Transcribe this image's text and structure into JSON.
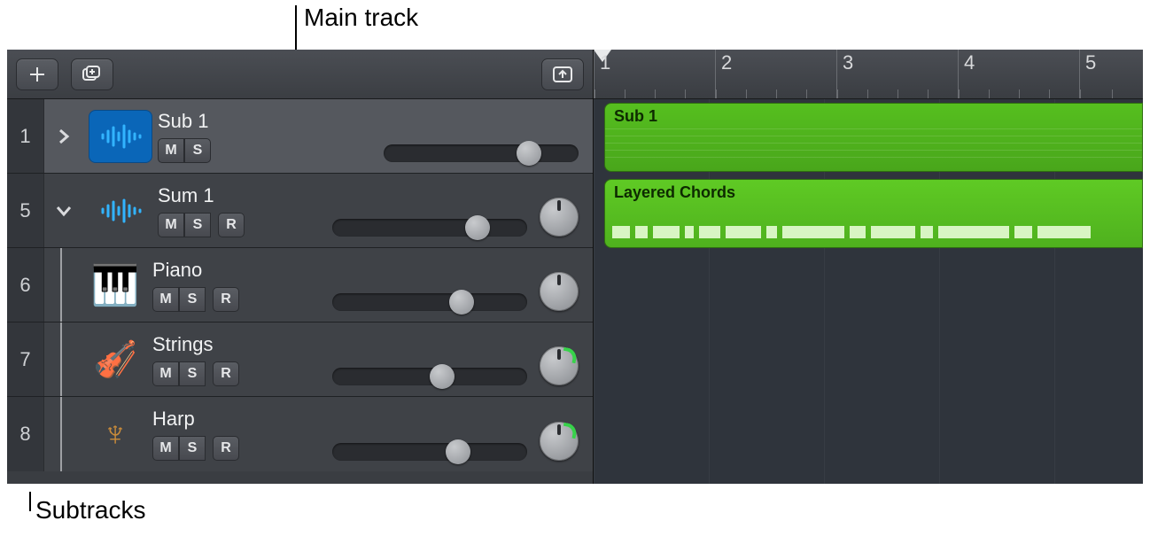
{
  "annotations": {
    "main_track": "Main track",
    "subtracks": "Subtracks"
  },
  "toolbar": {
    "add_label": "+",
    "add_track_stack_label": "⊕",
    "collapse_label": "⤒"
  },
  "ruler": {
    "marks": [
      "1",
      "2",
      "3",
      "4",
      "5"
    ]
  },
  "tracks": [
    {
      "number": "1",
      "name": "Sub 1",
      "expandable": true,
      "expanded": false,
      "selected": true,
      "icon": "audio-wave",
      "mute": "M",
      "solo": "S",
      "record": null,
      "has_pan": false,
      "volume_pos": 0.68
    },
    {
      "number": "5",
      "name": "Sum 1",
      "expandable": true,
      "expanded": true,
      "selected": false,
      "icon": "audio-wave",
      "mute": "M",
      "solo": "S",
      "record": "R",
      "has_pan": true,
      "pan_green": false,
      "volume_pos": 0.68
    },
    {
      "number": "6",
      "name": "Piano",
      "subtrack": true,
      "icon": "piano",
      "mute": "M",
      "solo": "S",
      "record": "R",
      "has_pan": true,
      "pan_green": false,
      "volume_pos": 0.6
    },
    {
      "number": "7",
      "name": "Strings",
      "subtrack": true,
      "icon": "strings",
      "mute": "M",
      "solo": "S",
      "record": "R",
      "has_pan": true,
      "pan_green": true,
      "volume_pos": 0.5
    },
    {
      "number": "8",
      "name": "Harp",
      "subtrack": true,
      "icon": "harp",
      "mute": "M",
      "solo": "S",
      "record": "R",
      "has_pan": true,
      "pan_green": true,
      "volume_pos": 0.58
    }
  ],
  "regions": [
    {
      "track_index": 0,
      "label": "Sub 1"
    },
    {
      "track_index": 1,
      "label": "Layered Chords"
    }
  ],
  "colors": {
    "region_green": "#54bd1f",
    "accent_blue": "#0a8bff"
  }
}
